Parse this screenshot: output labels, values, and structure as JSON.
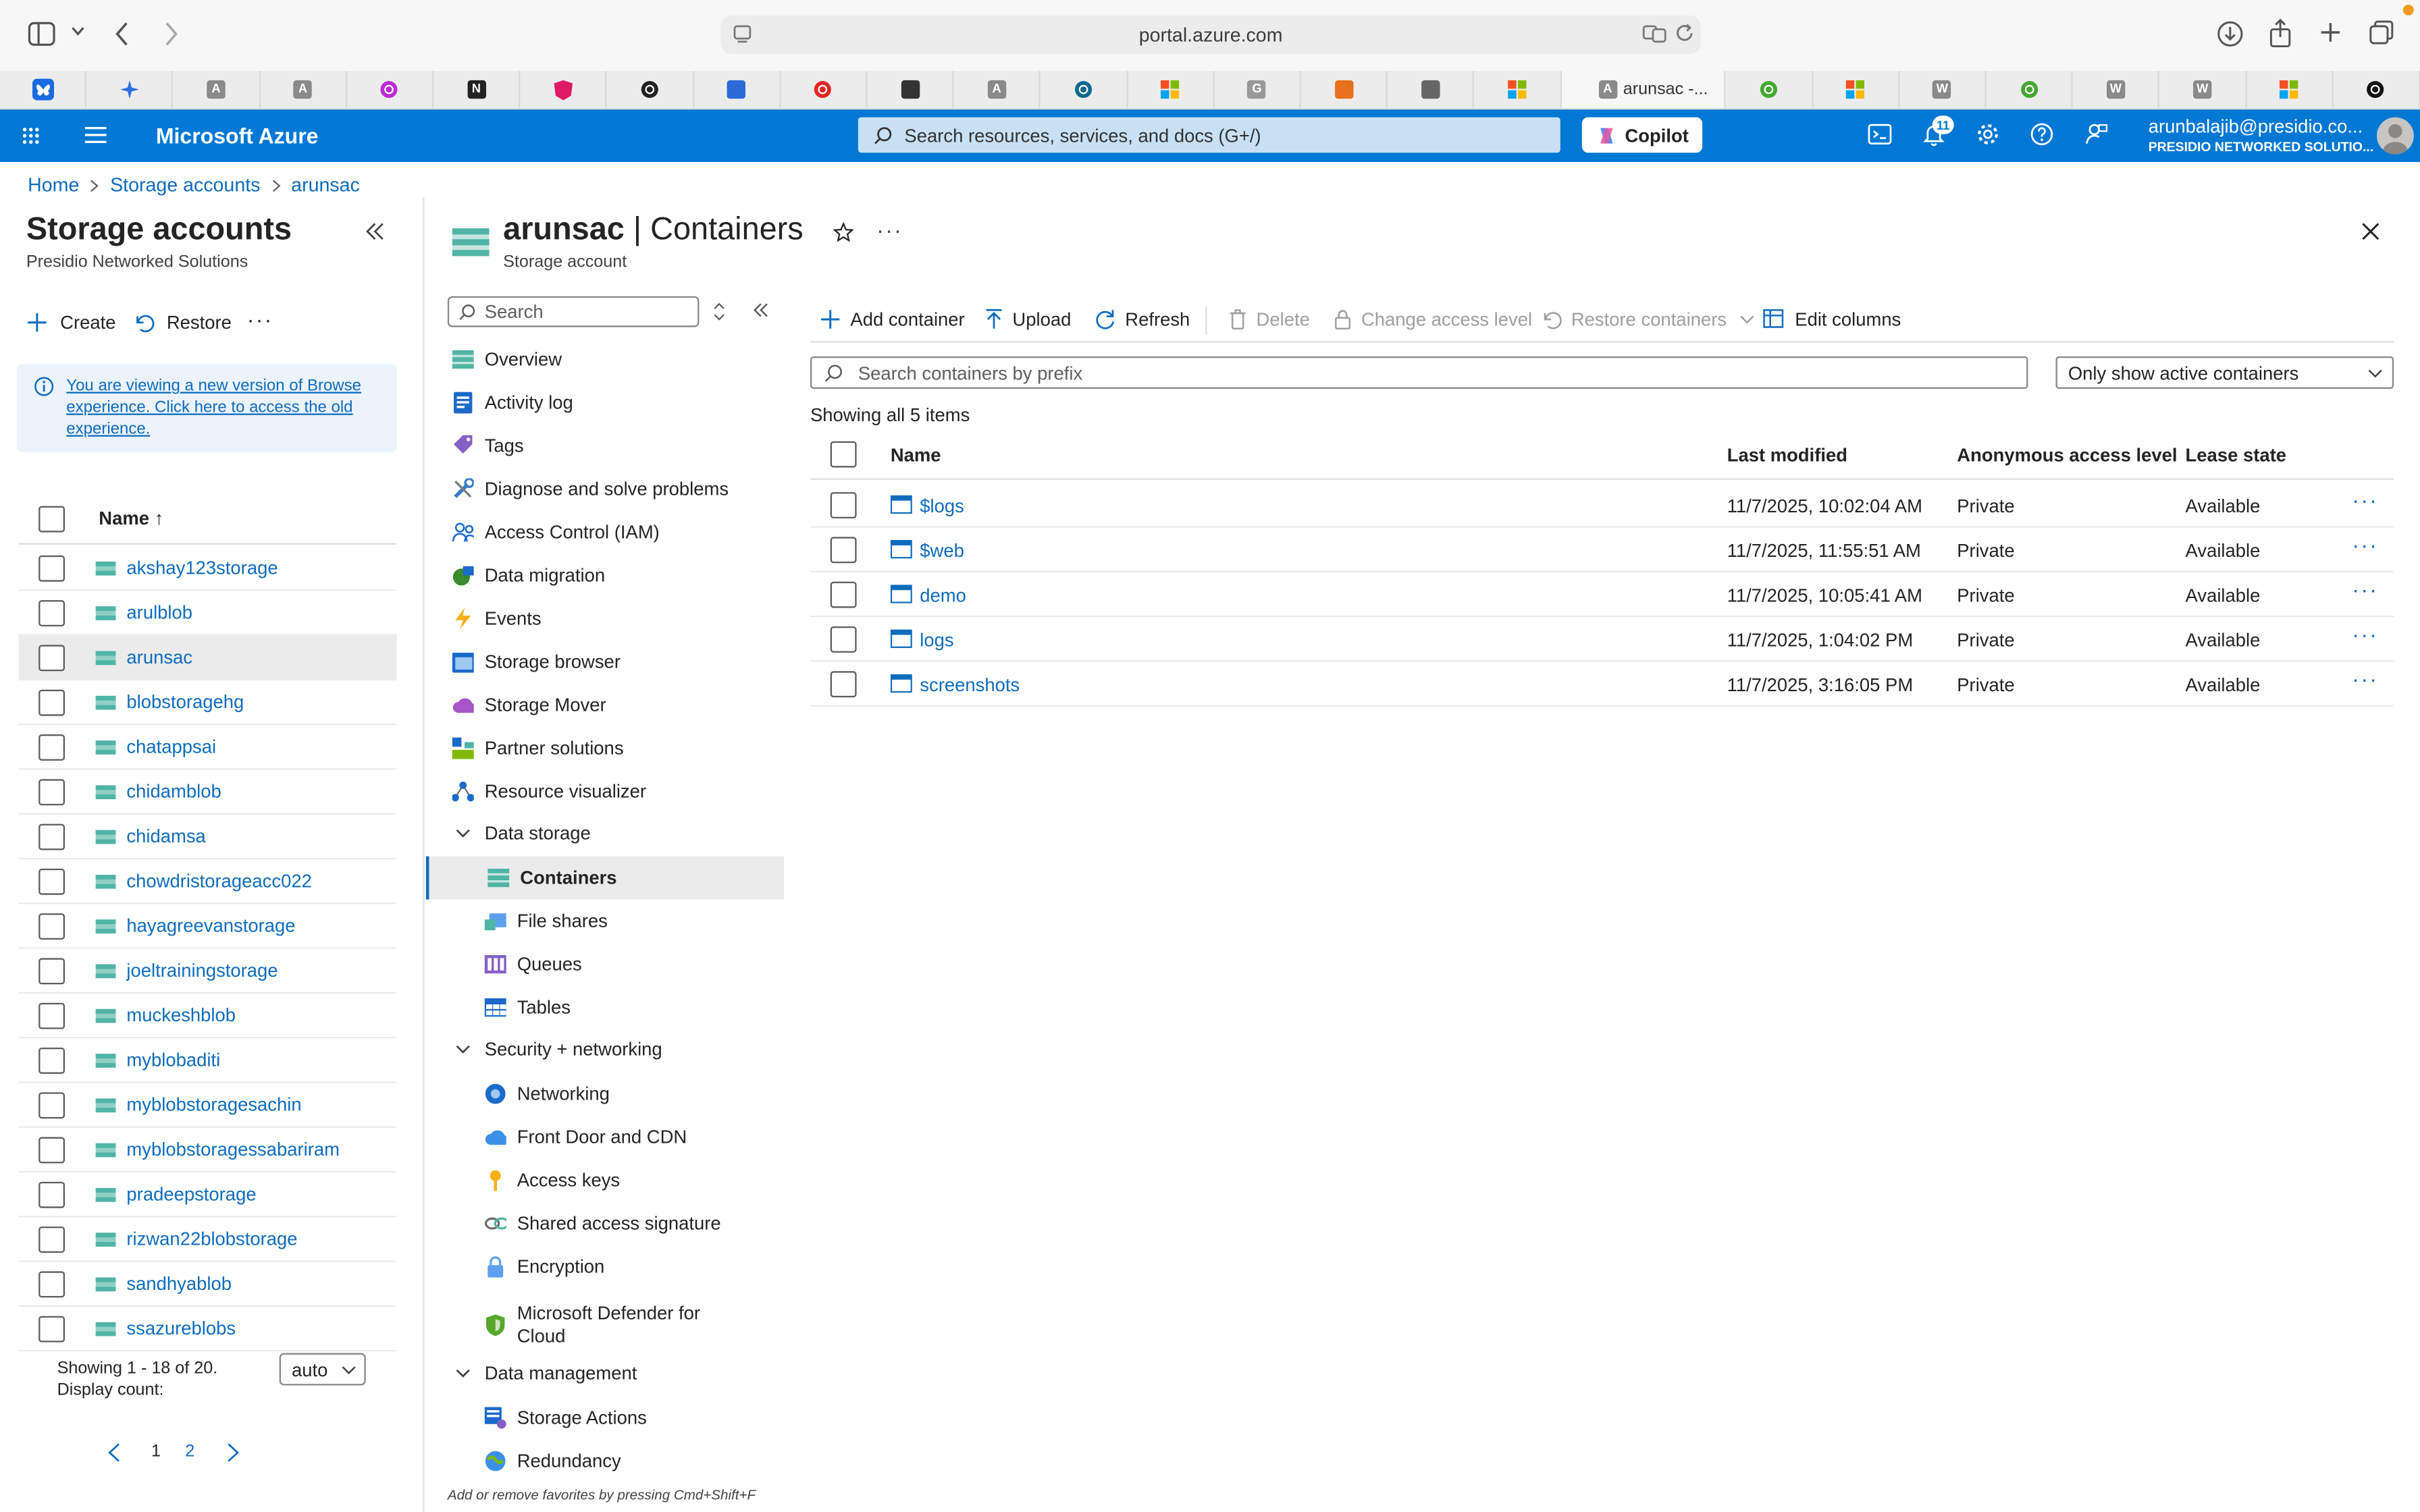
{
  "browser": {
    "url": "portal.azure.com",
    "active_tab_title": "arunsac -...",
    "tab_icons": [
      "bluesky-icon",
      "sparkle-icon",
      "a-icon",
      "a-icon",
      "music-icon",
      "notion-icon",
      "angular-icon",
      "github-icon",
      "vercel-icon",
      "opera-icon",
      "tools-icon",
      "a-icon",
      "edge-icon",
      "microsoft-icon",
      "g-icon",
      "grid-icon",
      "tree-icon",
      "microsoft-icon",
      "a-icon",
      "globe-icon",
      "microsoft-icon",
      "w-icon",
      "globe-icon",
      "w-icon",
      "w-icon",
      "microsoft-icon",
      "openai-icon"
    ]
  },
  "azure": {
    "brand": "Microsoft Azure",
    "search_placeholder": "Search resources, services, and docs (G+/)",
    "copilot": "Copilot",
    "notifications_count": "11",
    "user_email": "arunbalajib@presidio.co...",
    "user_org": "PRESIDIO NETWORKED SOLUTIO..."
  },
  "breadcrumb": [
    "Home",
    "Storage accounts",
    "arunsac"
  ],
  "left_panel": {
    "title": "Storage accounts",
    "subtitle": "Presidio Networked Solutions",
    "create": "Create",
    "restore": "Restore",
    "info_banner": "You are viewing a new version of Browse experience. Click here to access the old experience.",
    "name_header": "Name ↑",
    "accounts": [
      "akshay123storage",
      "arulblob",
      "arunsac",
      "blobstoragehg",
      "chatappsai",
      "chidamblob",
      "chidamsa",
      "chowdristorageacc022",
      "hayagreevanstorage",
      "joeltrainingstorage",
      "muckeshblob",
      "myblobaditi",
      "myblobstoragesachin",
      "myblobstoragessabariram",
      "pradeepstorage",
      "rizwan22blobstorage",
      "sandhyablob",
      "ssazureblobs"
    ],
    "selected": "arunsac",
    "showing": "Showing 1 - 18 of 20.",
    "display_count_label": "Display count:",
    "display_count_value": "auto",
    "pages": [
      "1",
      "2"
    ]
  },
  "resource": {
    "name": "arunsac",
    "separator": "|",
    "section": "Containers",
    "type": "Storage account",
    "menu_search_placeholder": "Search",
    "favorites_hint": "Add or remove favorites by pressing Cmd+Shift+F"
  },
  "menu": {
    "top": [
      {
        "label": "Overview",
        "icon": "overview-icon"
      },
      {
        "label": "Activity log",
        "icon": "activity-log-icon"
      },
      {
        "label": "Tags",
        "icon": "tag-icon"
      },
      {
        "label": "Diagnose and solve problems",
        "icon": "wrench-icon"
      },
      {
        "label": "Access Control (IAM)",
        "icon": "people-icon"
      },
      {
        "label": "Data migration",
        "icon": "migration-icon"
      },
      {
        "label": "Events",
        "icon": "lightning-icon"
      },
      {
        "label": "Storage browser",
        "icon": "storage-browser-icon"
      },
      {
        "label": "Storage Mover",
        "icon": "cloud-icon"
      },
      {
        "label": "Partner solutions",
        "icon": "partner-icon"
      },
      {
        "label": "Resource visualizer",
        "icon": "visualizer-icon"
      }
    ],
    "groups": [
      {
        "label": "Data storage",
        "items": [
          {
            "label": "Containers",
            "icon": "containers-icon"
          },
          {
            "label": "File shares",
            "icon": "file-share-icon"
          },
          {
            "label": "Queues",
            "icon": "queue-icon"
          },
          {
            "label": "Tables",
            "icon": "table-icon"
          }
        ]
      },
      {
        "label": "Security + networking",
        "items": [
          {
            "label": "Networking",
            "icon": "networking-icon"
          },
          {
            "label": "Front Door and CDN",
            "icon": "cdn-icon"
          },
          {
            "label": "Access keys",
            "icon": "key-icon"
          },
          {
            "label": "Shared access signature",
            "icon": "link-icon"
          },
          {
            "label": "Encryption",
            "icon": "lock-icon"
          },
          {
            "label": "Microsoft Defender for",
            "label2": "Cloud",
            "icon": "shield-icon"
          }
        ]
      },
      {
        "label": "Data management",
        "items": [
          {
            "label": "Storage Actions",
            "icon": "storage-actions-icon"
          },
          {
            "label": "Redundancy",
            "icon": "globe-icon"
          }
        ]
      }
    ]
  },
  "commands": {
    "add_container": "Add container",
    "upload": "Upload",
    "refresh": "Refresh",
    "delete": "Delete",
    "change_access": "Change access level",
    "restore_containers": "Restore containers",
    "edit_columns": "Edit columns"
  },
  "containers": {
    "search_placeholder": "Search containers by prefix",
    "filter": "Only show active containers",
    "showing": "Showing all 5 items",
    "columns": [
      "Name",
      "Last modified",
      "Anonymous access level",
      "Lease state"
    ],
    "rows": [
      {
        "name": "$logs",
        "modified": "11/7/2025, 10:02:04 AM",
        "access": "Private",
        "lease": "Available"
      },
      {
        "name": "$web",
        "modified": "11/7/2025, 11:55:51 AM",
        "access": "Private",
        "lease": "Available"
      },
      {
        "name": "demo",
        "modified": "11/7/2025, 10:05:41 AM",
        "access": "Private",
        "lease": "Available"
      },
      {
        "name": "logs",
        "modified": "11/7/2025, 1:04:02 PM",
        "access": "Private",
        "lease": "Available"
      },
      {
        "name": "screenshots",
        "modified": "11/7/2025, 3:16:05 PM",
        "access": "Private",
        "lease": "Available"
      }
    ]
  },
  "colors": {
    "azure_blue": "#0078d4",
    "link": "#0f6cbd",
    "storage_teal": "#50b4a6"
  }
}
